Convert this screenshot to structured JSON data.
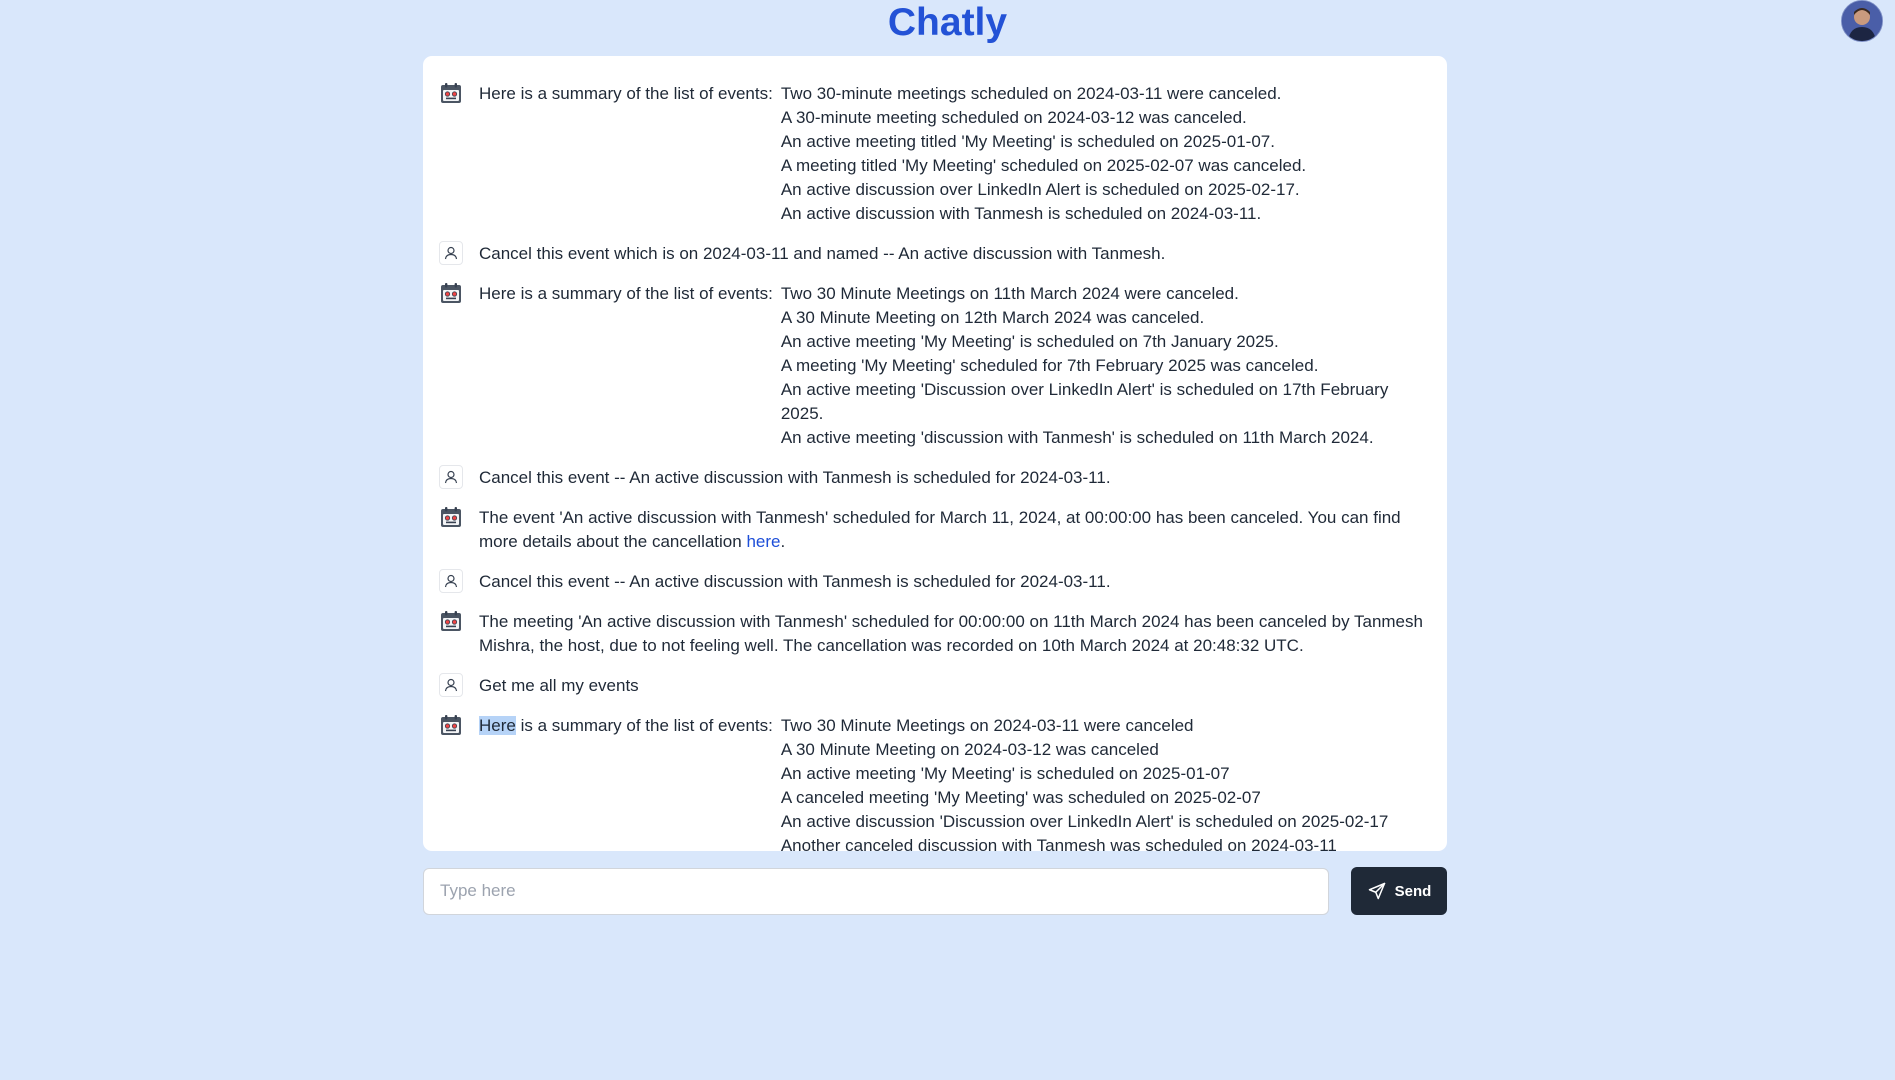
{
  "app": {
    "title": "Chatly"
  },
  "messages": [
    {
      "role": "bot",
      "lead": "Here is a summary of the list of events:",
      "items": [
        "Two 30-minute meetings scheduled on 2024-03-11 were canceled.",
        "A 30-minute meeting scheduled on 2024-03-12 was canceled.",
        "An active meeting titled 'My Meeting' is scheduled on 2025-01-07.",
        "A meeting titled 'My Meeting' scheduled on 2025-02-07 was canceled.",
        "An active discussion over LinkedIn Alert is scheduled on 2025-02-17.",
        "An active discussion with Tanmesh is scheduled on 2024-03-11."
      ]
    },
    {
      "role": "user",
      "text": "Cancel this event which is on 2024-03-11 and named -- An active discussion with Tanmesh."
    },
    {
      "role": "bot",
      "lead": "Here is a summary of the list of events:",
      "items": [
        "Two 30 Minute Meetings on 11th March 2024 were canceled.",
        "A 30 Minute Meeting on 12th March 2024 was canceled.",
        "An active meeting 'My Meeting' is scheduled on 7th January 2025.",
        "A meeting 'My Meeting' scheduled for 7th February 2025 was canceled.",
        "An active meeting 'Discussion over LinkedIn Alert' is scheduled on 17th February 2025.",
        "An active meeting 'discussion with Tanmesh' is scheduled on 11th March 2024."
      ]
    },
    {
      "role": "user",
      "text": "Cancel this event -- An active discussion with Tanmesh is scheduled for 2024-03-11."
    },
    {
      "role": "bot",
      "text": "The event 'An active discussion with Tanmesh' scheduled for March 11, 2024, at 00:00:00 has been canceled. You can find more details about the cancellation ",
      "link": "here",
      "after": "."
    },
    {
      "role": "user",
      "text": "Cancel this event -- An active discussion with Tanmesh is scheduled for 2024-03-11."
    },
    {
      "role": "bot",
      "text": "The meeting 'An active discussion with Tanmesh' scheduled for 00:00:00 on 11th March 2024 has been canceled by Tanmesh Mishra, the host, due to not feeling well. The cancellation was recorded on 10th March 2024 at 20:48:32 UTC."
    },
    {
      "role": "user",
      "text": "Get me all my events"
    },
    {
      "role": "bot",
      "lead_highlight": "Here",
      "lead": " is a summary of the list of events:",
      "items": [
        "Two 30 Minute Meetings on 2024-03-11 were canceled",
        "A 30 Minute Meeting on 2024-03-12 was canceled",
        "An active meeting 'My Meeting' is scheduled on 2025-01-07",
        "A canceled meeting 'My Meeting' was scheduled on 2025-02-07",
        "An active discussion 'Discussion over LinkedIn Alert' is scheduled on 2025-02-17",
        "Another canceled discussion with Tanmesh was scheduled on 2024-03-11"
      ]
    }
  ],
  "composer": {
    "placeholder": "Type here",
    "send_label": "Send"
  },
  "icons": {
    "bot": "calendar-bot-icon",
    "user": "user-icon",
    "send": "send-icon"
  },
  "colors": {
    "background": "#d9e7fb",
    "title": "#2352d6",
    "send_button": "#1f2937",
    "link": "#1d4ed8"
  }
}
